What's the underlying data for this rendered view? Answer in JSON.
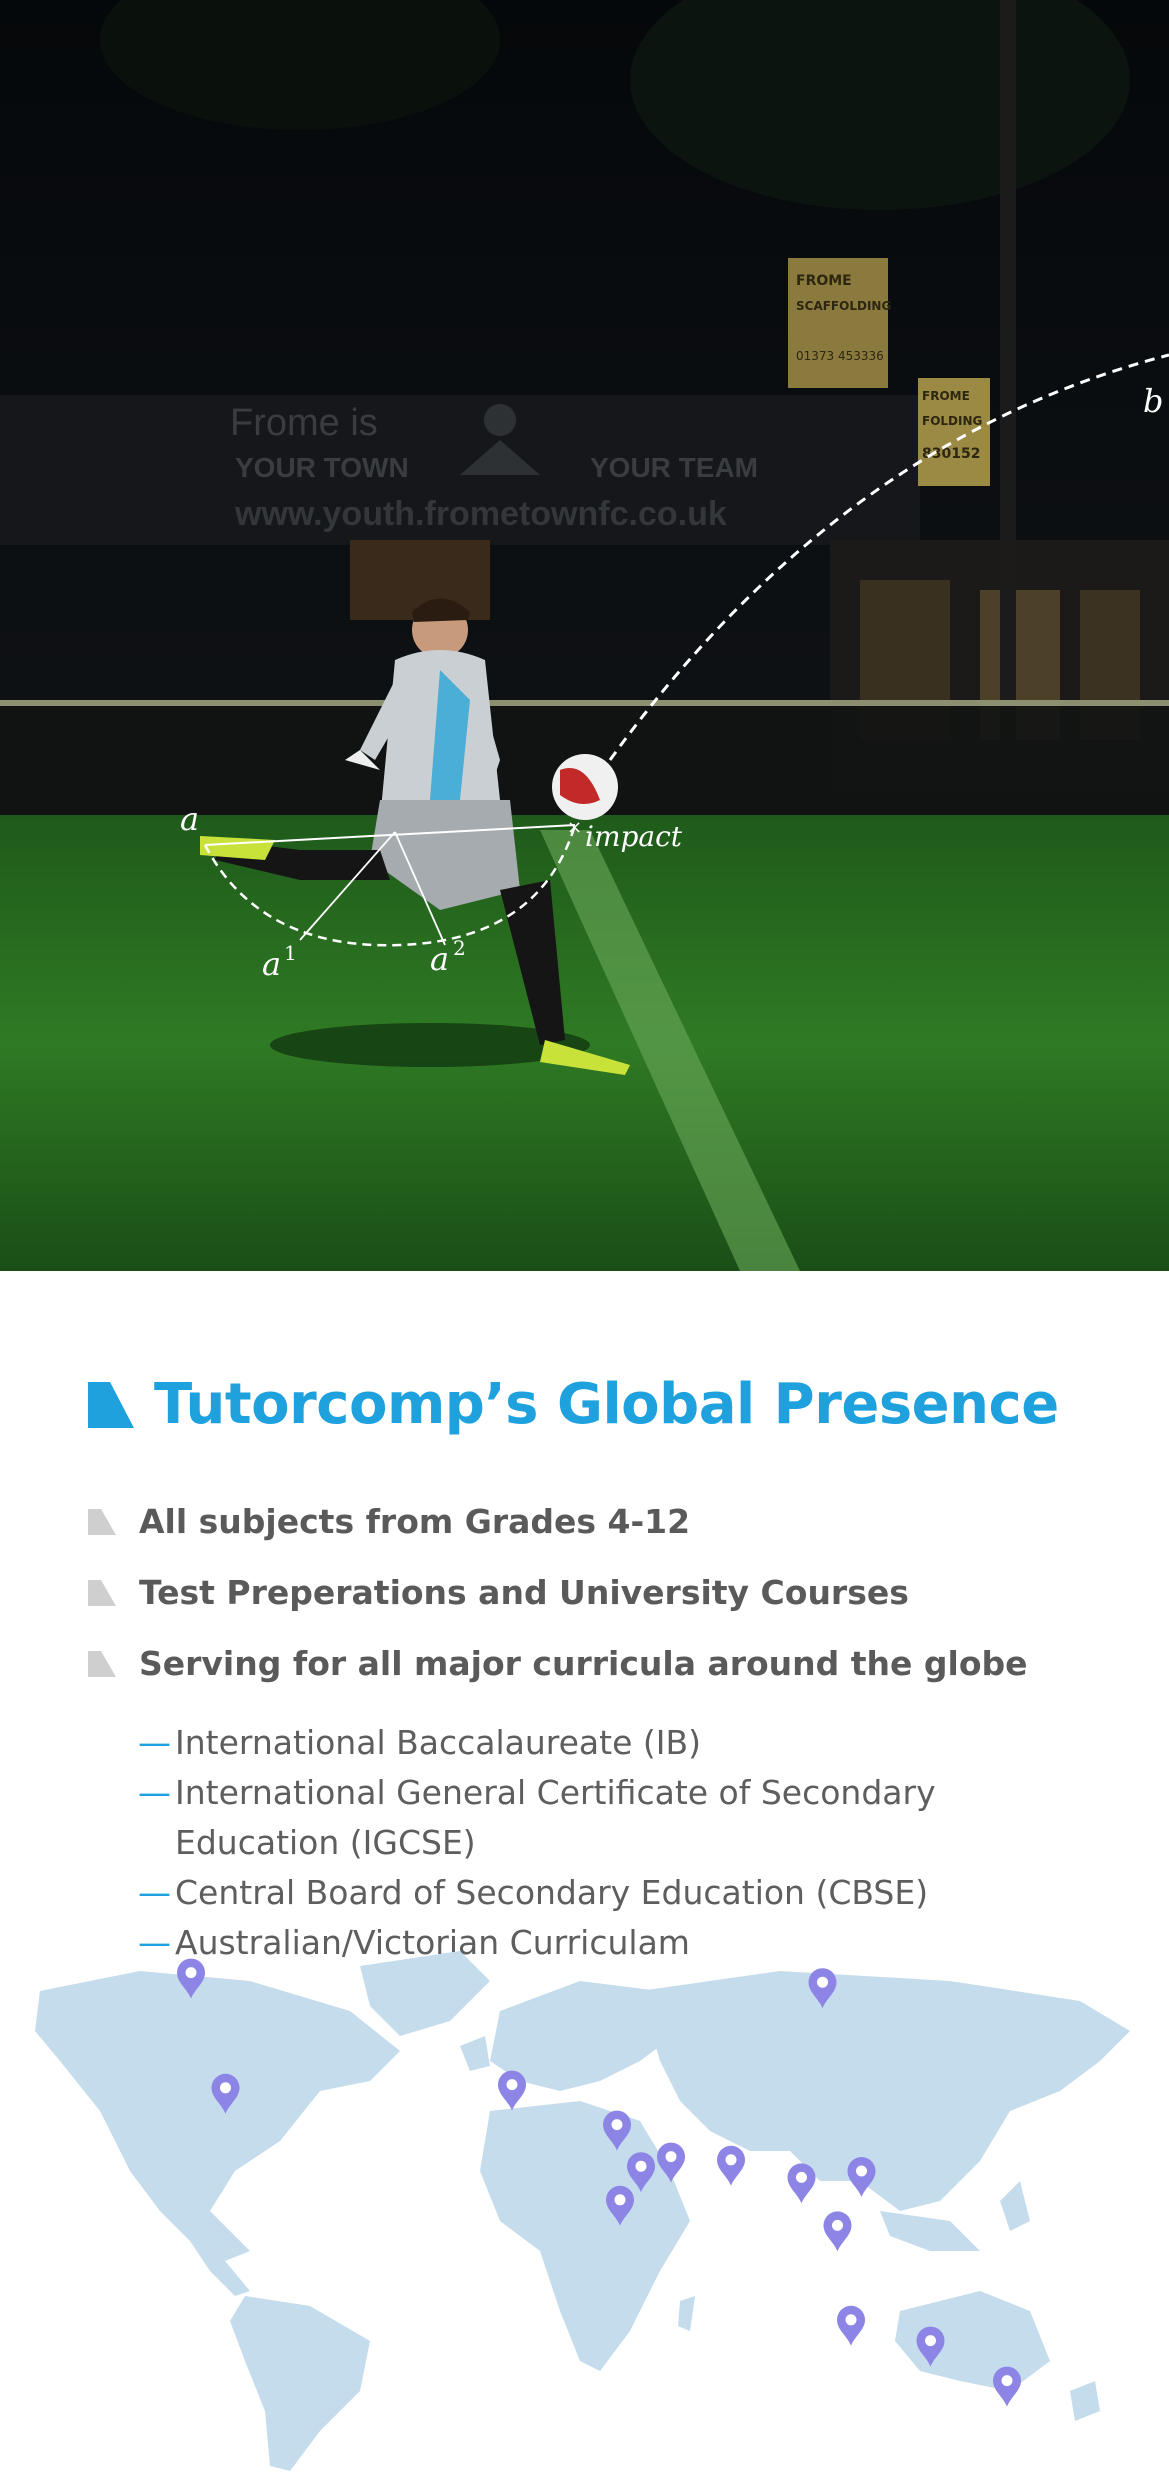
{
  "hero": {
    "banner_line1": "Frome is",
    "banner_line2a": "YOUR TOWN",
    "banner_line2b": "YOUR TEAM",
    "banner_url": "www.youth.frometownfc.co.uk",
    "sign1_line1": "FROME",
    "sign1_line2": "SCAFFOLDING",
    "sign1_line3": "01373 453336",
    "sign2_line1": "FROME",
    "sign2_line2": "FOLDING",
    "sign2_line3": "830152",
    "label_a": "a",
    "label_a1": "a",
    "label_a1_sup": "1",
    "label_a2": "a",
    "label_a2_sup": "2",
    "label_b": "b",
    "label_impact": "impact"
  },
  "section": {
    "title": "Tutorcomp’s Global Presence",
    "bullets": [
      "All subjects from Grades 4-12",
      "Test Preperations and University Courses",
      "Serving for all major curricula around the globe"
    ],
    "curricula": [
      "International Baccalaureate (IB)",
      "International General Certificate of Secondary Education (IGCSE)",
      "Central Board of Secondary Education (CBSE)",
      "Australian/Victorian Curriculam"
    ]
  },
  "colors": {
    "accent": "#1ea1dd",
    "bullet_gray": "#cfcfcf",
    "text_gray": "#5a5a5a",
    "map_land": "#c5dcec",
    "pin": "#8c85e6"
  },
  "icons": {
    "title_marker": "corner-triangle-icon",
    "bullet_marker": "corner-triangle-icon",
    "map_pin": "location-pin-icon"
  }
}
